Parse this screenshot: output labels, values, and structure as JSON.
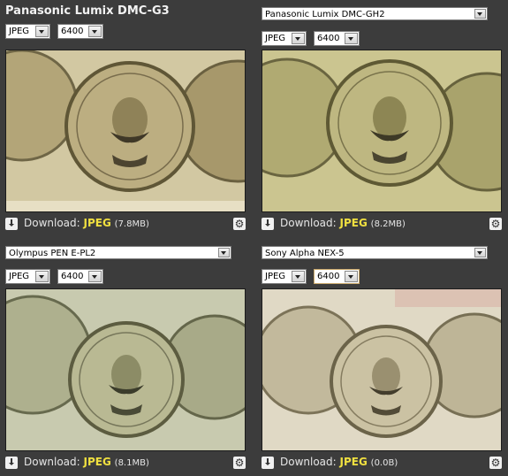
{
  "panels": [
    {
      "camera": "Panasonic Lumix DMC-G3",
      "camera_control": "title",
      "format": "JPEG",
      "iso": "6400",
      "download_label": "Download:",
      "download_format": "JPEG",
      "download_size": "(7.8MB)",
      "tint": "#cfc39a"
    },
    {
      "camera": "Panasonic Lumix DMC-GH2",
      "camera_control": "select",
      "format": "JPEG",
      "iso": "6400",
      "download_label": "Download:",
      "download_format": "JPEG",
      "download_size": "(8.2MB)",
      "tint": "#c9c38c"
    },
    {
      "camera": "Olympus PEN E-PL2",
      "camera_control": "select",
      "format": "JPEG",
      "iso": "6400",
      "download_label": "Download:",
      "download_format": "JPEG",
      "download_size": "(8.1MB)",
      "tint": "#c5c7a8"
    },
    {
      "camera": "Sony Alpha NEX-5",
      "camera_control": "select",
      "format": "JPEG",
      "iso": "6400",
      "download_label": "Download:",
      "download_format": "JPEG",
      "download_size": "(0.0B)",
      "tint": "#ddd6bf"
    }
  ],
  "icons": {
    "download": "download-icon",
    "settings": "gear-icon",
    "dropdown": "chevron-down-icon"
  },
  "colors": {
    "background": "#3c3c3c",
    "accent_format": "#f0e040"
  }
}
